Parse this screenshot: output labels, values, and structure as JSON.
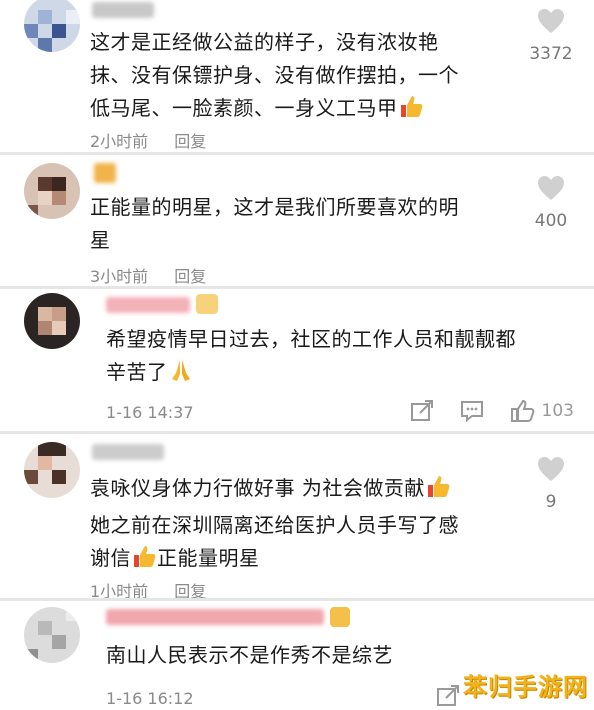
{
  "comments": [
    {
      "body_lines": [
        "这才是正经做公益的样子，没有浓妆艳",
        "抹、没有保镖护身、没有做作摆拍，一个",
        "低马尾、一脸素颜、一身义工马甲"
      ],
      "time": "2小时前",
      "reply": "回复",
      "likes": "3372",
      "emoji_after": "thumbs-up"
    },
    {
      "body_lines": [
        "正能量的明星，这才是我们所要喜欢的明",
        "星"
      ],
      "time": "3小时前",
      "reply": "回复",
      "likes": "400"
    },
    {
      "body_lines": [
        "希望疫情早日过去，社区的工作人员和靓靓都",
        "辛苦了"
      ],
      "time": "1-16 14:37",
      "likes": "103",
      "emoji_after": "praying-hands"
    },
    {
      "body_lines": [
        "袁咏仪身体力行做好事 为社会做贡献",
        "她之前在深圳隔离还给医护人员手写了感",
        "谢信"
      ],
      "line3_suffix": "正能量明星",
      "time": "1小时前",
      "reply": "回复",
      "likes": "9"
    },
    {
      "body_lines": [
        "南山人民表示不是作秀不是综艺"
      ],
      "time": "1-16 16:12"
    }
  ],
  "watermark": "苯归手游网",
  "colors": {
    "meta": "#8a8a8a",
    "like_icon": "#d0d0d0",
    "accent_thumb": "#f5a623",
    "watermark": "#f2b21a"
  }
}
